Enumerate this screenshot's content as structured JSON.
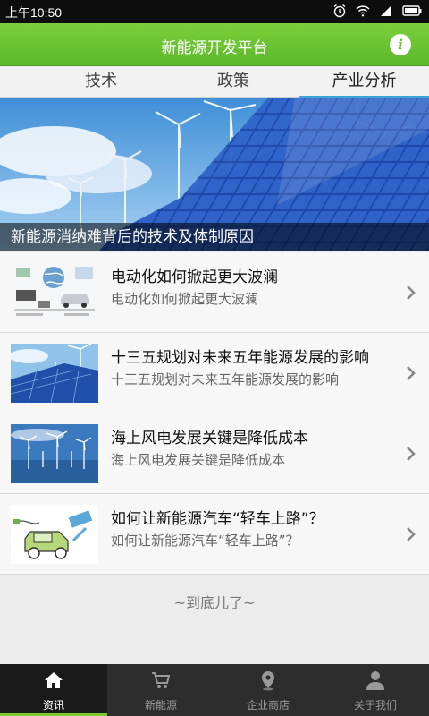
{
  "status_bar": {
    "time": "上午10:50"
  },
  "header": {
    "title": "新能源开发平台",
    "info_icon": "i"
  },
  "tabs": [
    {
      "label": "技术",
      "active": false
    },
    {
      "label": "政策",
      "active": false
    },
    {
      "label": "产业分析",
      "active": true
    }
  ],
  "banner": {
    "caption": "新能源消纳难背后的技术及体制原因"
  },
  "articles": [
    {
      "title": "电动化如何掀起更大波澜",
      "subtitle": "电动化如何掀起更大波澜"
    },
    {
      "title": "十三五规划对未来五年能源发展的影响",
      "subtitle": "十三五规划对未来五年能源发展的影响"
    },
    {
      "title": "海上风电发展关键是降低成本",
      "subtitle": "海上风电发展关键是降低成本"
    },
    {
      "title": "如何让新能源汽车“轻车上路”？",
      "subtitle": "如何让新能源汽车“轻车上路”？"
    }
  ],
  "list_end": "~到底儿了~",
  "bottom_nav": [
    {
      "label": "资讯",
      "icon": "home-icon",
      "active": true
    },
    {
      "label": "新能源",
      "icon": "cart-icon",
      "active": false
    },
    {
      "label": "企业商店",
      "icon": "location-pin-icon",
      "active": false
    },
    {
      "label": "关于我们",
      "icon": "user-icon",
      "active": false
    }
  ],
  "colors": {
    "accent_green": "#6ac02f",
    "tab_indicator": "#3aa5d6",
    "nav_bg": "#2d2d2d"
  }
}
